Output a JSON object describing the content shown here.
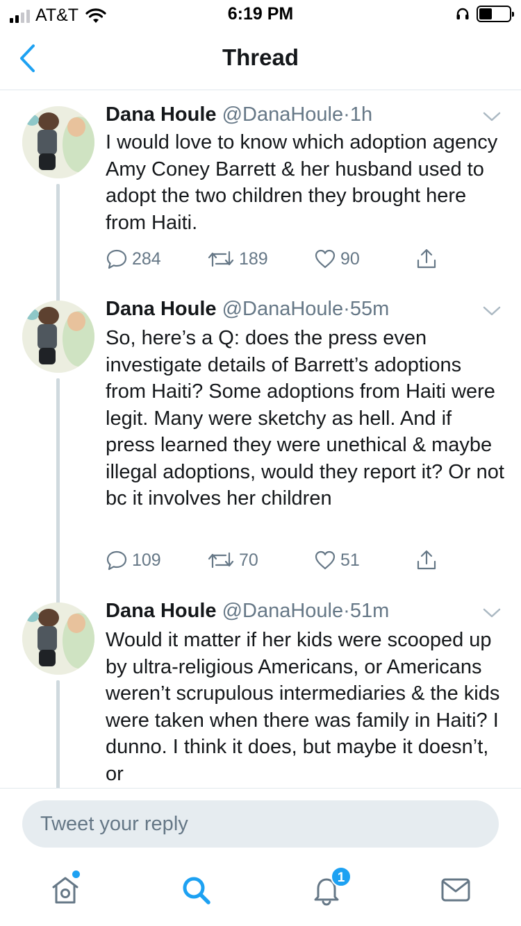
{
  "status_bar": {
    "carrier": "AT&T",
    "time": "6:19 PM",
    "signal_bars_active": 2,
    "battery_level": 0.42
  },
  "nav": {
    "back_icon": "chevron-left-icon",
    "title": "Thread"
  },
  "tweets": [
    {
      "name": "Dana Houle",
      "handle": "@DanaHoule",
      "dot": "·",
      "time": "1h",
      "text": "I would love to know which adoption agency Amy Coney Barrett & her husband used to adopt the two children they brought here from Haiti.",
      "replies": "284",
      "retweets": "189",
      "likes": "90"
    },
    {
      "name": "Dana Houle",
      "handle": "@DanaHoule",
      "dot": "·",
      "time": "55m",
      "text": "So, here’s a Q: does the press even investigate details of Barrett’s adoptions from Haiti? Some adoptions from Haiti were legit. Many were sketchy as hell. And if press learned they were unethical & maybe illegal adoptions, would they report it? Or not bc it involves her children",
      "replies": "109",
      "retweets": "70",
      "likes": "51"
    },
    {
      "name": "Dana Houle",
      "handle": "@DanaHoule",
      "dot": "·",
      "time": "51m",
      "text": "Would it matter if her kids were scooped up by ultra-religious Americans, or Americans weren’t scrupulous intermediaries & the kids were taken when there was family in Haiti? I dunno. I think it does, but maybe it doesn’t, or"
    }
  ],
  "reply": {
    "placeholder": "Tweet your reply"
  },
  "tab_bar": {
    "items": [
      "home-icon",
      "search-icon",
      "notifications-icon",
      "messages-icon"
    ],
    "notifications_badge": "1",
    "accent_color": "#1da1f2"
  }
}
